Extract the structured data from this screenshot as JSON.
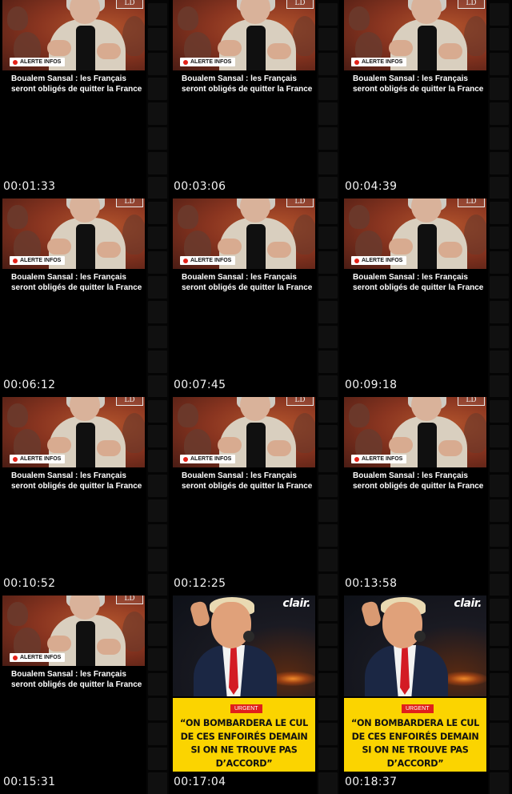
{
  "clips": [
    {
      "type": "sansal",
      "timestamp": "00:01:33"
    },
    {
      "type": "sansal",
      "timestamp": "00:03:06"
    },
    {
      "type": "sansal",
      "timestamp": "00:04:39"
    },
    {
      "type": "sansal",
      "timestamp": "00:06:12"
    },
    {
      "type": "sansal",
      "timestamp": "00:07:45"
    },
    {
      "type": "sansal",
      "timestamp": "00:09:18"
    },
    {
      "type": "sansal",
      "timestamp": "00:10:52"
    },
    {
      "type": "sansal",
      "timestamp": "00:12:25"
    },
    {
      "type": "sansal",
      "timestamp": "00:13:58"
    },
    {
      "type": "sansal",
      "timestamp": "00:15:31"
    },
    {
      "type": "trump",
      "timestamp": "00:17:04"
    },
    {
      "type": "trump",
      "timestamp": "00:18:37"
    }
  ],
  "sansal": {
    "badge": "ALERTE INFOS",
    "headline": "Boualem Sansal : les Français seront obligés de quitter la France",
    "logo": "LD"
  },
  "trump": {
    "brand": "clair.",
    "urgent": "URGENT",
    "quote": "“ON BOMBARDERA LE CUL DE CES ENFOIRÉS DEMAIN SI ON NE TROUVE PAS D’ACCORD”"
  },
  "colors": {
    "background": "#000000",
    "alert_red": "#e32119",
    "quote_yellow": "#fbd400",
    "urgent_red": "#e0201b"
  }
}
